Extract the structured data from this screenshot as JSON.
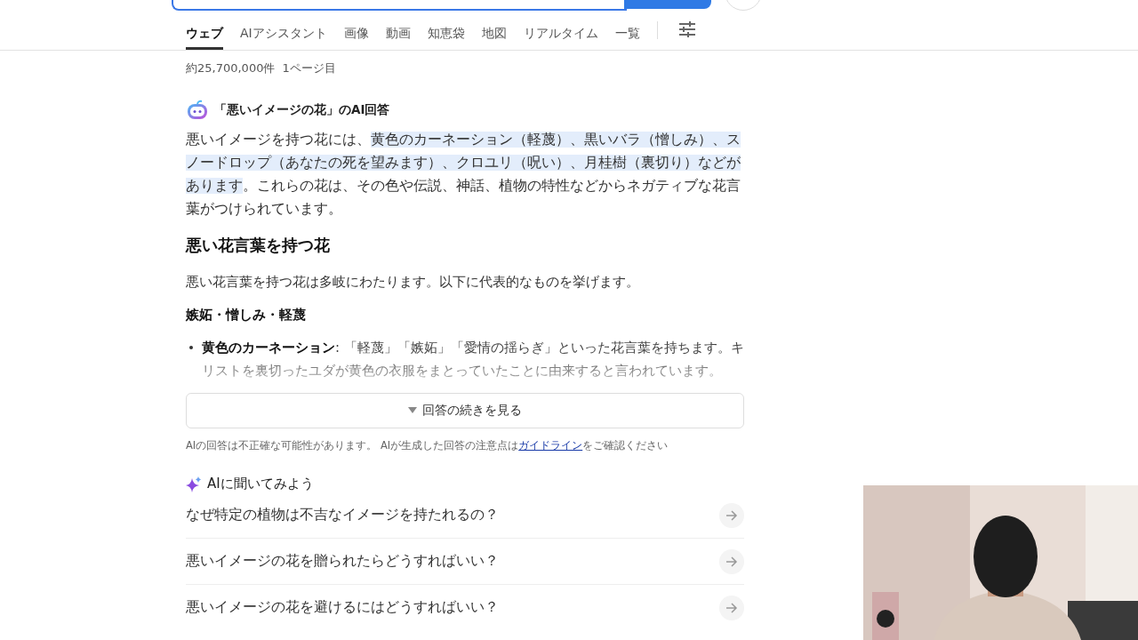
{
  "tabs": [
    {
      "label": "ウェブ",
      "selected": true
    },
    {
      "label": "AIアシスタント",
      "selected": false
    },
    {
      "label": "画像",
      "selected": false
    },
    {
      "label": "動画",
      "selected": false
    },
    {
      "label": "知恵袋",
      "selected": false
    },
    {
      "label": "地図",
      "selected": false
    },
    {
      "label": "リアルタイム",
      "selected": false
    },
    {
      "label": "一覧",
      "selected": false
    }
  ],
  "result_count": "約25,700,000件",
  "page_label": "1ページ目",
  "ai_answer": {
    "title": "「悪いイメージの花」のAI回答",
    "summary": [
      {
        "text": "悪いイメージを持つ花には、",
        "highlighted": false
      },
      {
        "text": "黄色のカーネーション（軽蔑）、黒いバラ（憎しみ）、スノードロップ（あなたの死を望みます）、クロユリ（呪い）、月桂樹（裏切り）などがあります",
        "highlighted": true
      },
      {
        "text": "。これらの花は、その色や伝説、神話、植物の特性などからネガティブな花言葉がつけられています。",
        "highlighted": false
      }
    ],
    "heading": "悪い花言葉を持つ花",
    "intro": "悪い花言葉を持つ花は多岐にわたります。以下に代表的なものを挙げます。",
    "subheading": "嫉妬・憎しみ・軽蔑",
    "bullets": [
      "**黄色のカーネーション**: 「軽蔑」「嫉妬」「愛情の揺らぎ」といった花言葉を持ちます。キリストを裏切ったユダが黄色の衣服をまとっていたことに由来すると言われています。"
    ],
    "more_button": "回答の続きを見る",
    "disclaimer": "AIの回答は不正確な可能性があります。 AIが生成した回答の注意点は",
    "disclaimer_link": "ガイドライン",
    "disclaimer_end": "をご確認ください"
  },
  "ask_ai": {
    "title": "AIに聞いてみよう",
    "questions": [
      "なぜ特定の植物は不吉なイメージを持たれるの？",
      "悪いイメージの花を贈られたらどうすればいい？",
      "悪いイメージの花を避けるにはどうすればいい？"
    ]
  }
}
